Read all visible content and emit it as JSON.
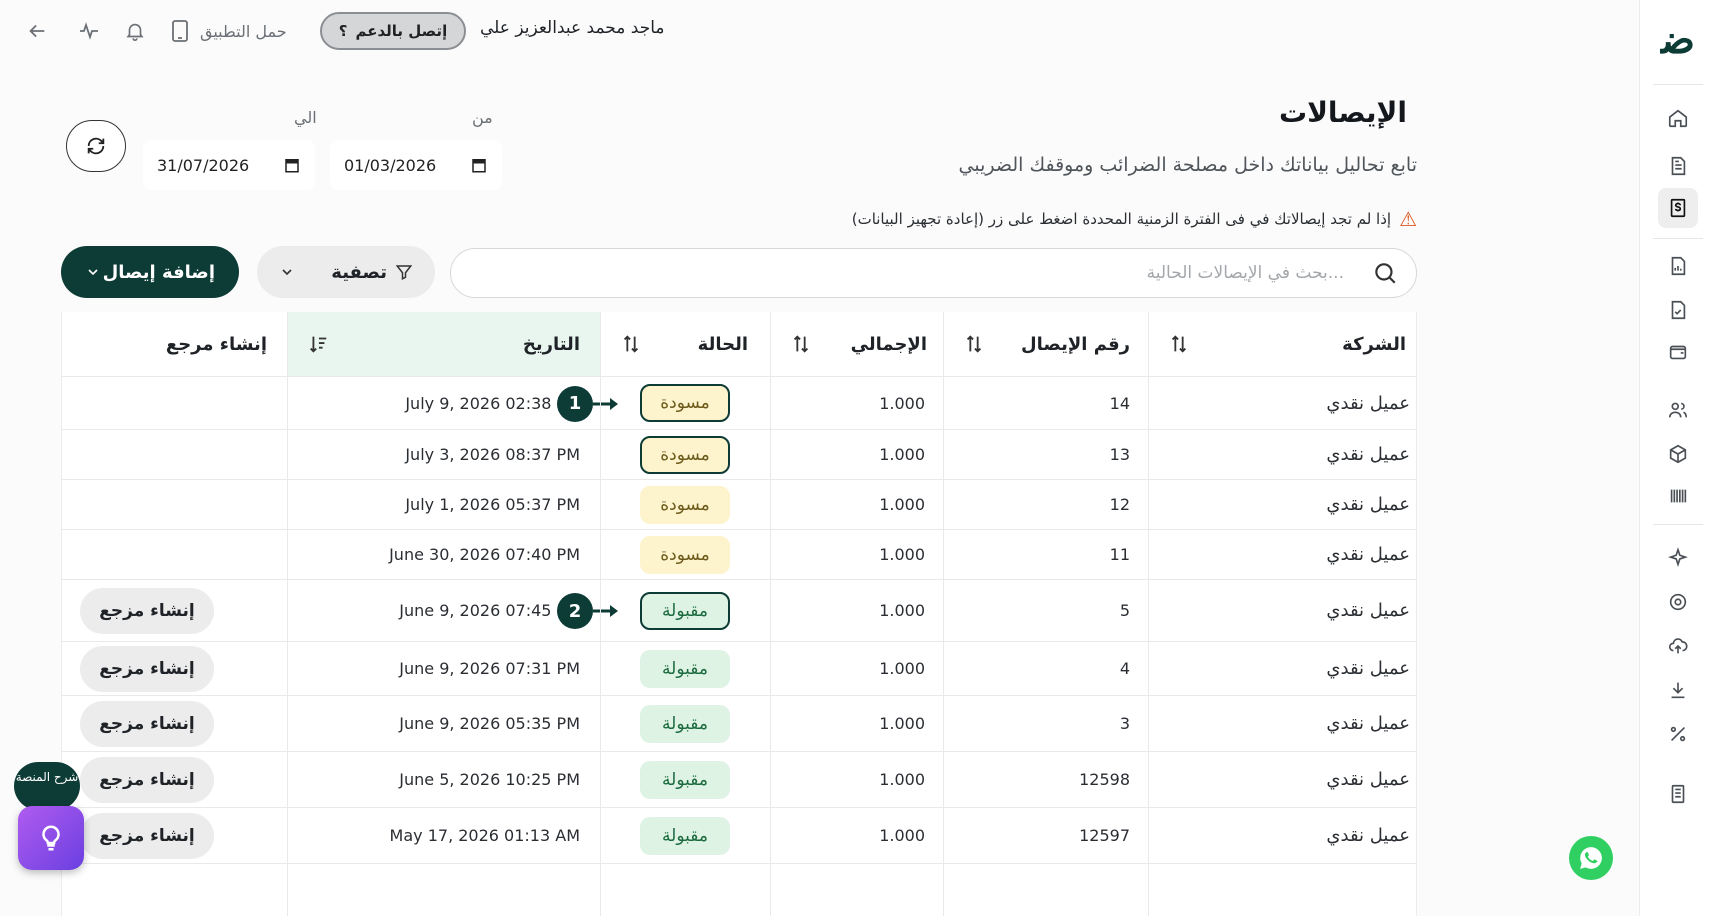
{
  "topbar": {
    "app_download": "حمل التطبيق",
    "support": "إتصل بالدعم",
    "support_mark": "؟",
    "user_name": "ماجد محمد عبدالعزيز علي"
  },
  "header": {
    "title": "الإيصالات",
    "subtitle": "تابع تحاليل بياناتك داخل مصلحة الضرائب وموقفك الضريبي",
    "notice": "إذا لم تجد إيصالاتك في فى الفترة الزمنية المحددة اضغط على زر (إعادة تجهيز البيانات)"
  },
  "dates": {
    "from_label": "من",
    "from_value": "01/03/2026",
    "to_label": "الي",
    "to_value": "31/07/2026"
  },
  "toolbar": {
    "search_placeholder": "بحث في الإيصالات الحالية...",
    "filter_label": "تصفية",
    "add_label": "إضافة إيصال"
  },
  "table": {
    "headers": {
      "company": "الشركة",
      "receipt_no": "رقم الإيصال",
      "total": "الإجمالي",
      "status": "الحالة",
      "date": "التاريخ",
      "create_ref": "إنشاء مرجع"
    },
    "rows": [
      {
        "company": "عميل نقدي",
        "receipt_no": "14",
        "total": "1.000",
        "status": "مسودة",
        "date": "July 9, 2026 02:38 PM",
        "action": ""
      },
      {
        "company": "عميل نقدي",
        "receipt_no": "13",
        "total": "1.000",
        "status": "مسودة",
        "date": "July 3, 2026 08:37 PM",
        "action": ""
      },
      {
        "company": "عميل نقدي",
        "receipt_no": "12",
        "total": "1.000",
        "status": "مسودة",
        "date": "July 1, 2026 05:37 PM",
        "action": ""
      },
      {
        "company": "عميل نقدي",
        "receipt_no": "11",
        "total": "1.000",
        "status": "مسودة",
        "date": "June 30, 2026 07:40 PM",
        "action": ""
      },
      {
        "company": "عميل نقدي",
        "receipt_no": "5",
        "total": "1.000",
        "status": "مقبولة",
        "date": "June 9, 2026 07:45 PM",
        "action": "إنشاء مزجع"
      },
      {
        "company": "عميل نقدي",
        "receipt_no": "4",
        "total": "1.000",
        "status": "مقبولة",
        "date": "June 9, 2026 07:31 PM",
        "action": "إنشاء مزجع"
      },
      {
        "company": "عميل نقدي",
        "receipt_no": "3",
        "total": "1.000",
        "status": "مقبولة",
        "date": "June 9, 2026 05:35 PM",
        "action": "إنشاء مزجع"
      },
      {
        "company": "عميل نقدي",
        "receipt_no": "12598",
        "total": "1.000",
        "status": "مقبولة",
        "date": "June 5, 2026 10:25 PM",
        "action": "إنشاء مزجع"
      },
      {
        "company": "عميل نقدي",
        "receipt_no": "12597",
        "total": "1.000",
        "status": "مقبولة",
        "date": "May 17, 2026 01:13 AM",
        "action": "إنشاء مزجع"
      }
    ]
  },
  "markers": {
    "one": "1",
    "two": "2"
  },
  "floating": {
    "platform_help": "شرح المنصة"
  },
  "colors": {
    "brand": "#0d3b36",
    "draft_bg": "#fdf3cc",
    "accepted_bg": "#dff3e4",
    "date_header_bg": "#e9f6ef"
  }
}
